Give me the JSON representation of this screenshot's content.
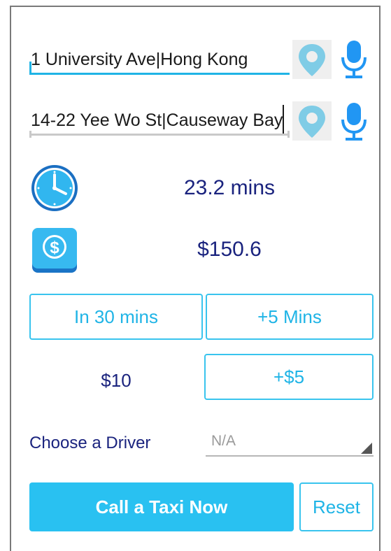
{
  "route": {
    "origin": "1 University Ave|Hong Kong",
    "destination": "14-22 Yee Wo St|Causeway Bay"
  },
  "trip": {
    "duration": "23.2 mins",
    "fare": "$150.6"
  },
  "time_options": {
    "schedule_label": "In 30 mins",
    "add_time_label": "+5 Mins"
  },
  "tip": {
    "amount": "$10",
    "add_label": "+$5"
  },
  "driver": {
    "label": "Choose a Driver",
    "selected": "N/A"
  },
  "actions": {
    "call_label": "Call a Taxi Now",
    "reset_label": "Reset"
  },
  "icons": {
    "pin": "map-pin-icon",
    "mic": "microphone-icon",
    "clock": "clock-icon",
    "money": "dollar-icon"
  },
  "colors": {
    "accent": "#29c1f1",
    "outline": "#39c4ee",
    "text_dark_blue": "#1a237e",
    "pin": "#7fcce6"
  }
}
